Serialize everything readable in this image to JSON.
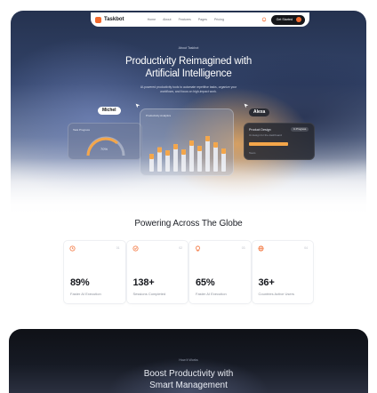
{
  "nav": {
    "brand": "Taskbot",
    "links": [
      "Home",
      "About",
      "Features",
      "Pages",
      "Pricing"
    ],
    "cta": "Get Started"
  },
  "hero": {
    "kicker": "About Taskbot",
    "title_line1": "Productivity Reimagined with",
    "title_line2": "Artificial Intelligence",
    "description": "AI-powered productivity tools to automate repetitive tasks, organize your workflows, and focus on high-impact work."
  },
  "cursors": {
    "left": "Michel",
    "right": "Alexa"
  },
  "cards": {
    "left": {
      "title": "Task Progress",
      "value": "70%"
    },
    "center": {
      "title": "Productivity Analytics"
    },
    "right": {
      "title": "Product Design",
      "status": "In Progress",
      "subtitle": "Ui design for the dashboard",
      "footer": "Team"
    }
  },
  "chart_data": {
    "type": "bar",
    "values": [
      40,
      55,
      48,
      62,
      50,
      70,
      58,
      80,
      66,
      52
    ],
    "colors": {
      "accent": "#f4a64a",
      "base": "#e6e8ee"
    }
  },
  "stats_section": {
    "title": "Powering Across The Globe",
    "items": [
      {
        "index": "01",
        "value": "89%",
        "label": "Faster AI Execution",
        "icon": "clock-icon"
      },
      {
        "index": "02",
        "value": "138+",
        "label": "Sessions Completed",
        "icon": "check-circle-icon"
      },
      {
        "index": "03",
        "value": "65%",
        "label": "Faster AI Execution",
        "icon": "bulb-icon"
      },
      {
        "index": "04",
        "value": "36+",
        "label": "Countries Active Users",
        "icon": "globe-icon"
      }
    ]
  },
  "next_section": {
    "kicker": "How It Works",
    "title_line1": "Boost Productivity with",
    "title_line2": "Smart Management"
  },
  "colors": {
    "accent": "#f26a2e",
    "dark": "#15161a"
  }
}
